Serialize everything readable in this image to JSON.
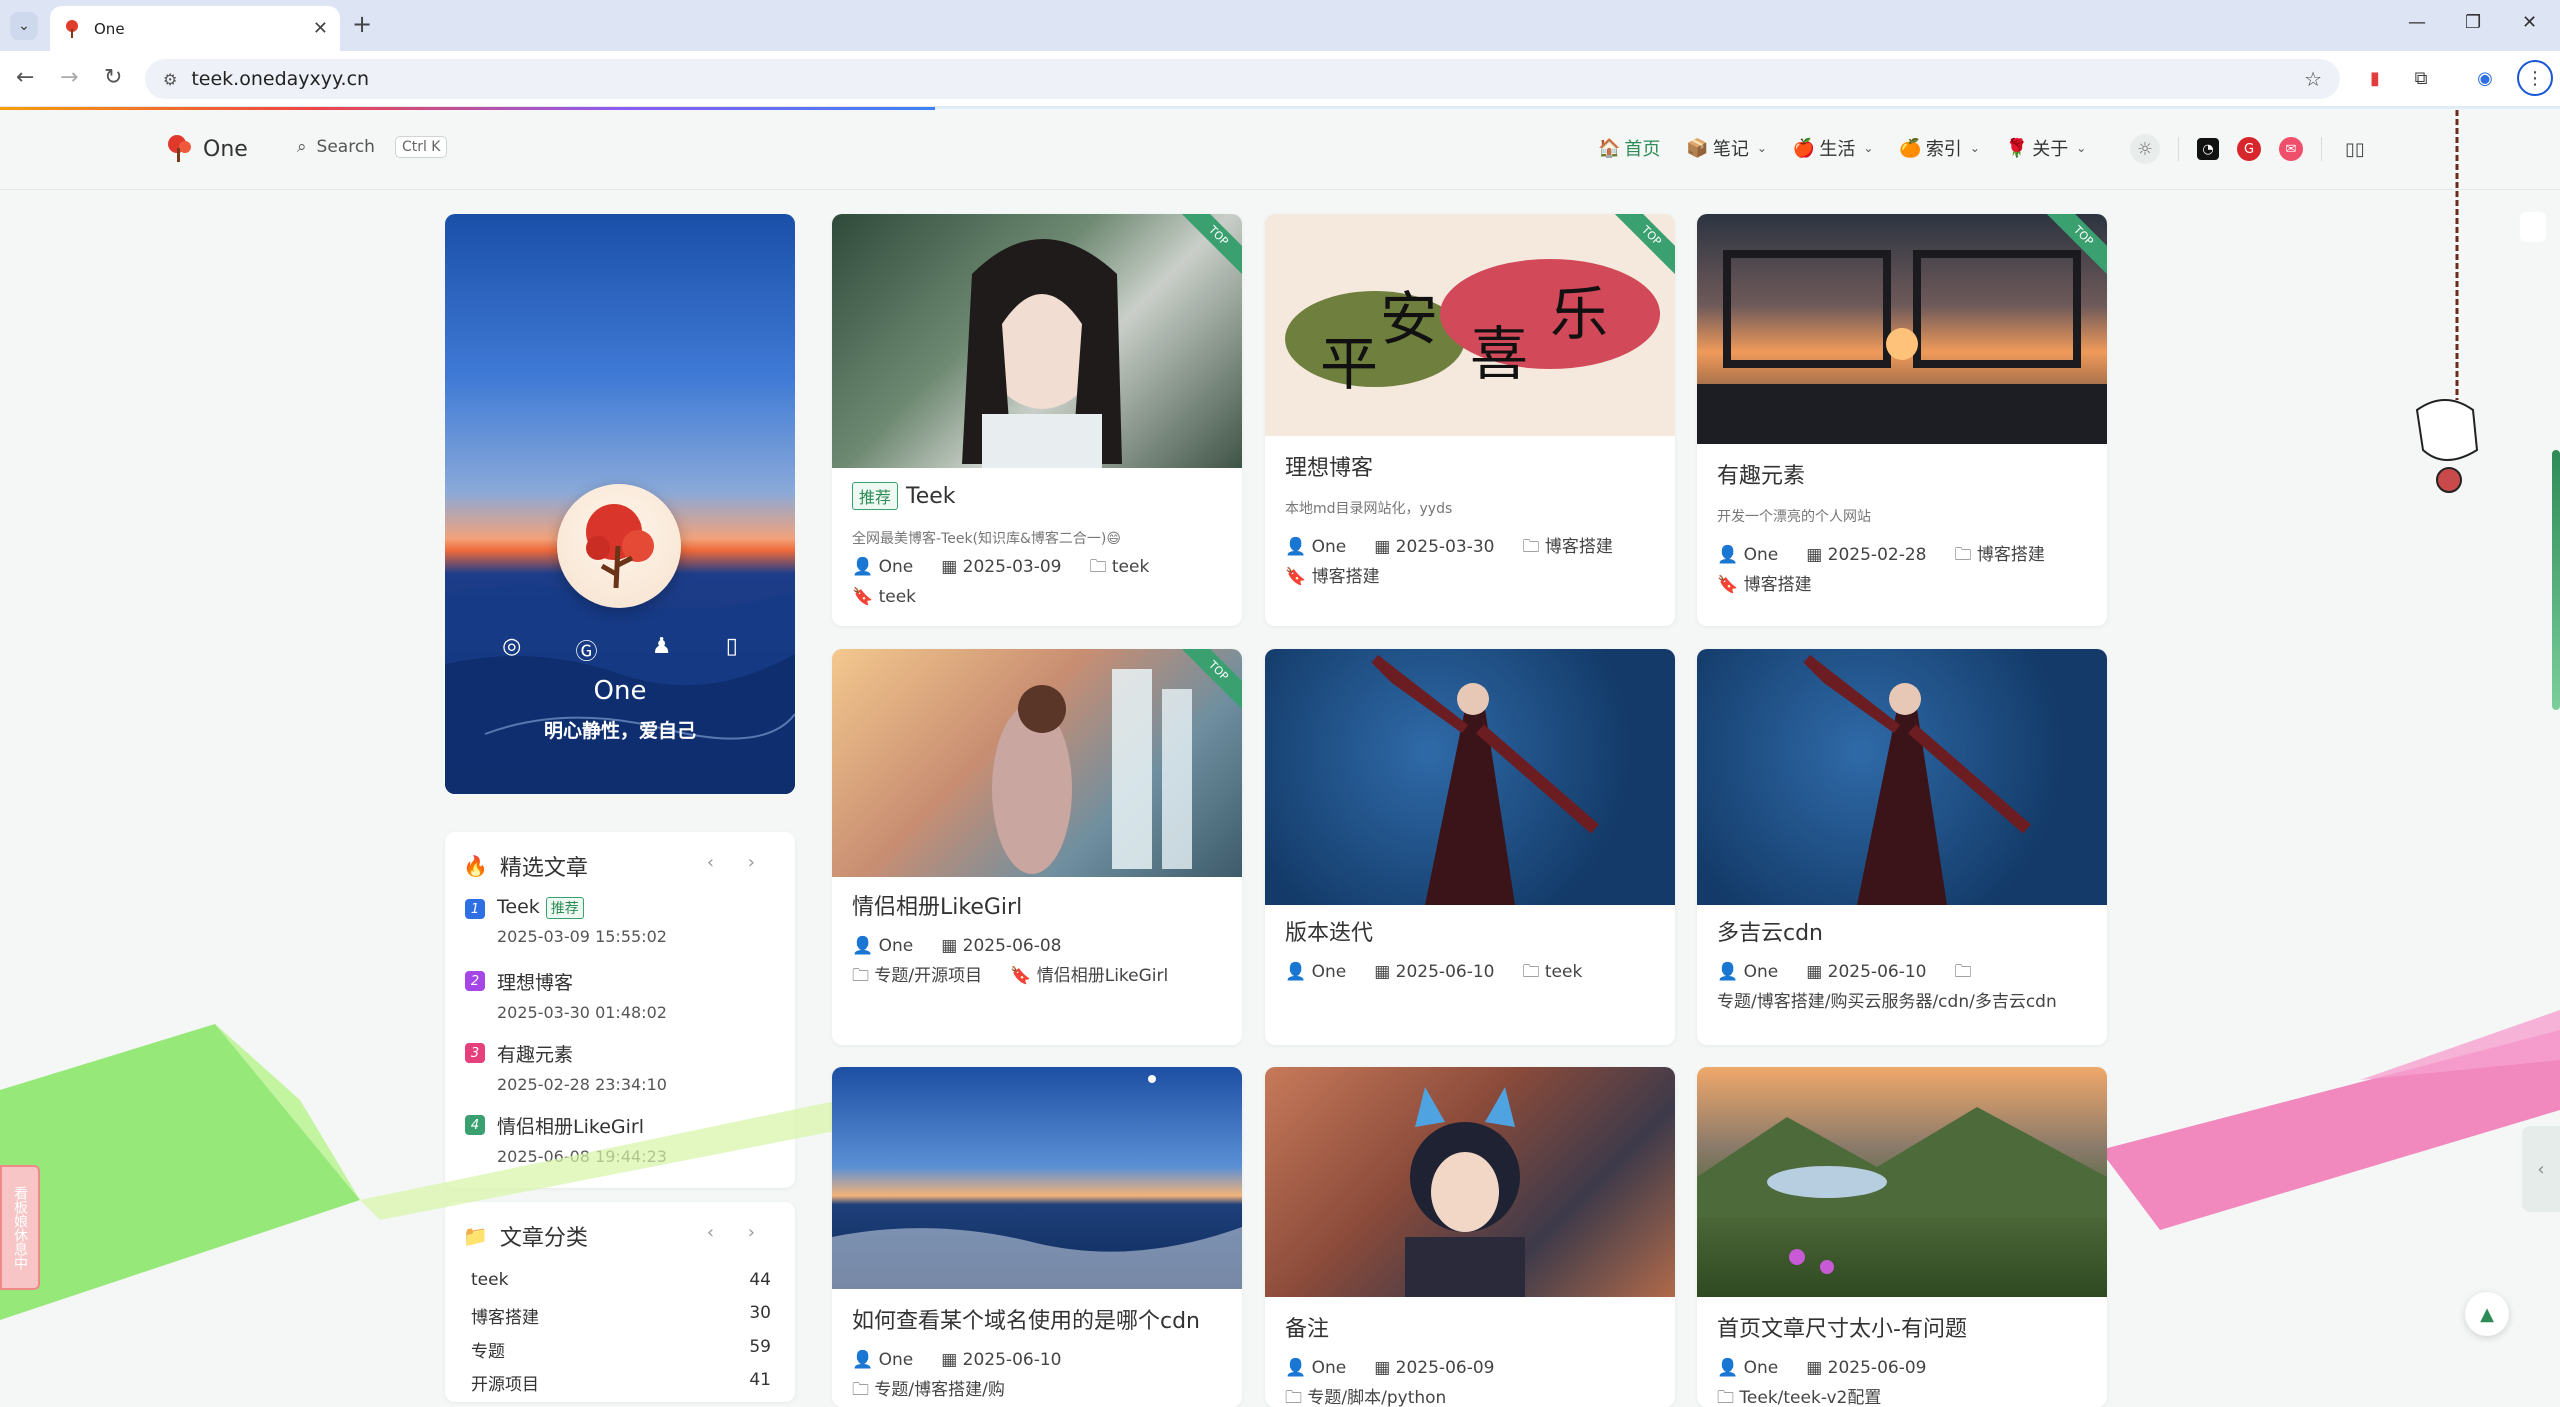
{
  "browser": {
    "tab_title": "One",
    "url": "teek.onedayxyy.cn",
    "new_tab": "+",
    "close_tab": "✕"
  },
  "site": {
    "brand": "One",
    "search_label": "Search",
    "search_shortcut": "Ctrl K",
    "menu": [
      {
        "label": "首页",
        "icon": "home-icon",
        "active": true
      },
      {
        "label": "笔记",
        "icon": "notes-icon",
        "dropdown": true
      },
      {
        "label": "生活",
        "icon": "life-icon",
        "dropdown": true
      },
      {
        "label": "索引",
        "icon": "index-icon",
        "dropdown": true
      },
      {
        "label": "关于",
        "icon": "about-icon",
        "dropdown": true
      }
    ]
  },
  "profile": {
    "name": "One",
    "motto": "明心静性，爱自己",
    "socials": [
      "github-icon",
      "gitee-icon",
      "qq-icon",
      "phone-icon"
    ]
  },
  "featured": {
    "title": "精选文章",
    "items": [
      {
        "num": "1",
        "title": "Teek",
        "tag": "推荐",
        "date": "2025-03-09 15:55:02",
        "color": "#2f6fe4"
      },
      {
        "num": "2",
        "title": "理想博客",
        "date": "2025-03-30 01:48:02",
        "color": "#a547e6"
      },
      {
        "num": "3",
        "title": "有趣元素",
        "date": "2025-02-28 23:34:10",
        "color": "#e5407a"
      },
      {
        "num": "4",
        "title": "情侣相册LikeGirl",
        "date": "2025-06-08 19:44:23",
        "color": "#3aa070"
      }
    ]
  },
  "categories": {
    "title": "文章分类",
    "items": [
      {
        "name": "teek",
        "count": "44"
      },
      {
        "name": "博客搭建",
        "count": "30"
      },
      {
        "name": "专题",
        "count": "59"
      },
      {
        "name": "开源项目",
        "count": "41"
      }
    ]
  },
  "posts": [
    {
      "title": "Teek",
      "tag": "推荐",
      "desc": "全网最美博客-Teek(知识库&博客二合一)😄",
      "top": "TOP",
      "meta": [
        "One",
        "2025-03-09",
        "teek",
        "teek"
      ]
    },
    {
      "title": "理想博客",
      "desc": "本地md目录网站化，yyds",
      "top": "TOP",
      "meta": [
        "One",
        "2025-03-30",
        "博客搭建",
        "博客搭建"
      ],
      "banner": [
        "平",
        "安",
        "喜",
        "乐"
      ]
    },
    {
      "title": "有趣元素",
      "desc": "开发一个漂亮的个人网站",
      "top": "TOP",
      "meta": [
        "One",
        "2025-02-28",
        "博客搭建",
        "博客搭建"
      ]
    },
    {
      "title": "情侣相册LikeGirl",
      "top": "TOP",
      "meta": [
        "One",
        "2025-06-08",
        "专题/开源项目",
        "情侣相册LikeGirl"
      ]
    },
    {
      "title": "版本迭代",
      "meta": [
        "One",
        "2025-06-10",
        "teek"
      ]
    },
    {
      "title": "多吉云cdn",
      "meta": [
        "One",
        "2025-06-10",
        "专题/博客搭建/购买云服务器/cdn/多吉云cdn"
      ]
    },
    {
      "title": "如何查看某个域名使用的是哪个cdn",
      "meta": [
        "One",
        "2025-06-10",
        "专题/博客搭建/购"
      ]
    },
    {
      "title": "备注",
      "meta": [
        "One",
        "2025-06-09",
        "专题/脚本/python"
      ]
    },
    {
      "title": "首页文章尺寸太小-有问题",
      "meta": [
        "One",
        "2025-06-09",
        "Teek/teek-v2配置"
      ]
    }
  ],
  "widgets": {
    "sidetab": "看板娘休息中"
  }
}
